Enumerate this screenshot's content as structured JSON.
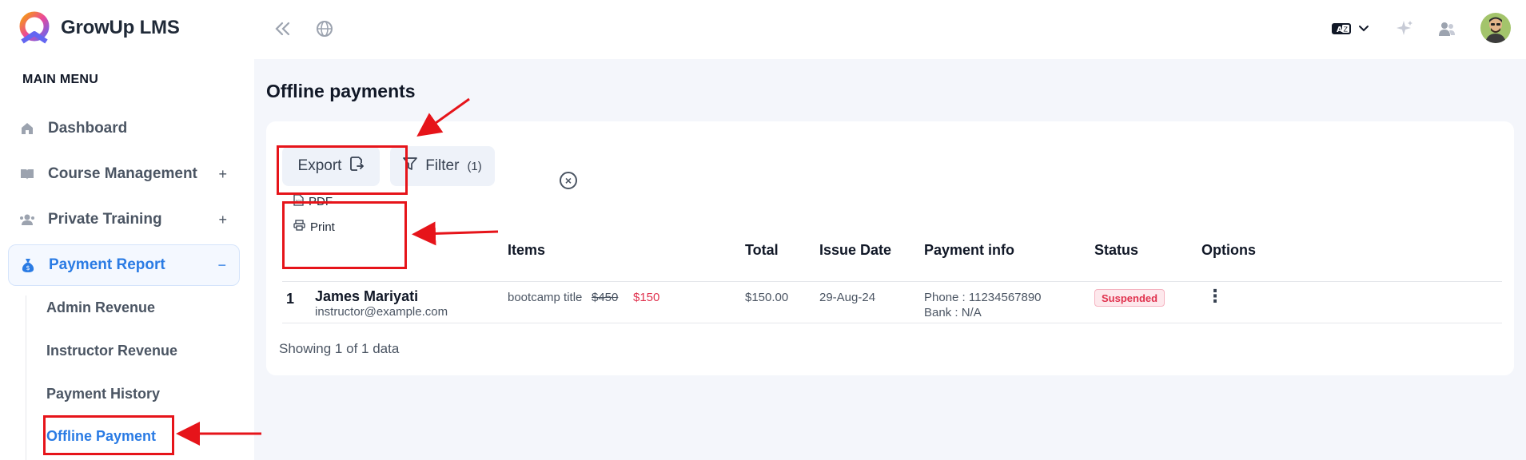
{
  "app": {
    "name": "GrowUp LMS"
  },
  "sidebar": {
    "menu_label": "MAIN MENU",
    "items": [
      {
        "label": "Dashboard",
        "icon": "home-icon",
        "expand": ""
      },
      {
        "label": "Course Management",
        "icon": "book-icon",
        "expand": "+"
      },
      {
        "label": "Private Training",
        "icon": "people-icon",
        "expand": "+"
      },
      {
        "label": "Payment Report",
        "icon": "money-bag-icon",
        "expand": "−"
      }
    ],
    "sub_items": [
      {
        "label": "Admin Revenue"
      },
      {
        "label": "Instructor Revenue"
      },
      {
        "label": "Payment History"
      },
      {
        "label": "Offline Payment"
      }
    ]
  },
  "topbar": {
    "icons": [
      "collapse-sidebar-icon",
      "globe-icon",
      "language-icon",
      "chevron-down-icon",
      "sparkle-icon",
      "users-icon",
      "avatar"
    ]
  },
  "page": {
    "title": "Offline payments",
    "export_label": "Export",
    "filter_label": "Filter",
    "filter_count": "(1)",
    "export_menu": [
      "PDF",
      "Print"
    ]
  },
  "table": {
    "columns": [
      "Items",
      "Total",
      "Issue Date",
      "Payment info",
      "Status",
      "Options"
    ],
    "rows": [
      {
        "index": "1",
        "name": "James Mariyati",
        "email": "instructor@example.com",
        "item": "bootcamp title",
        "old_price": "$450",
        "price": "$150",
        "total": "$150.00",
        "issue_date": "29-Aug-24",
        "phone": "Phone : 11234567890",
        "bank": "Bank : N/A",
        "status": "Suspended"
      }
    ],
    "footer": "Showing 1 of 1 data"
  },
  "colors": {
    "accent": "#2a7be4",
    "annotation": "#e6141a",
    "status_suspended": "#e0334f",
    "price_discount": "#e0334f"
  }
}
